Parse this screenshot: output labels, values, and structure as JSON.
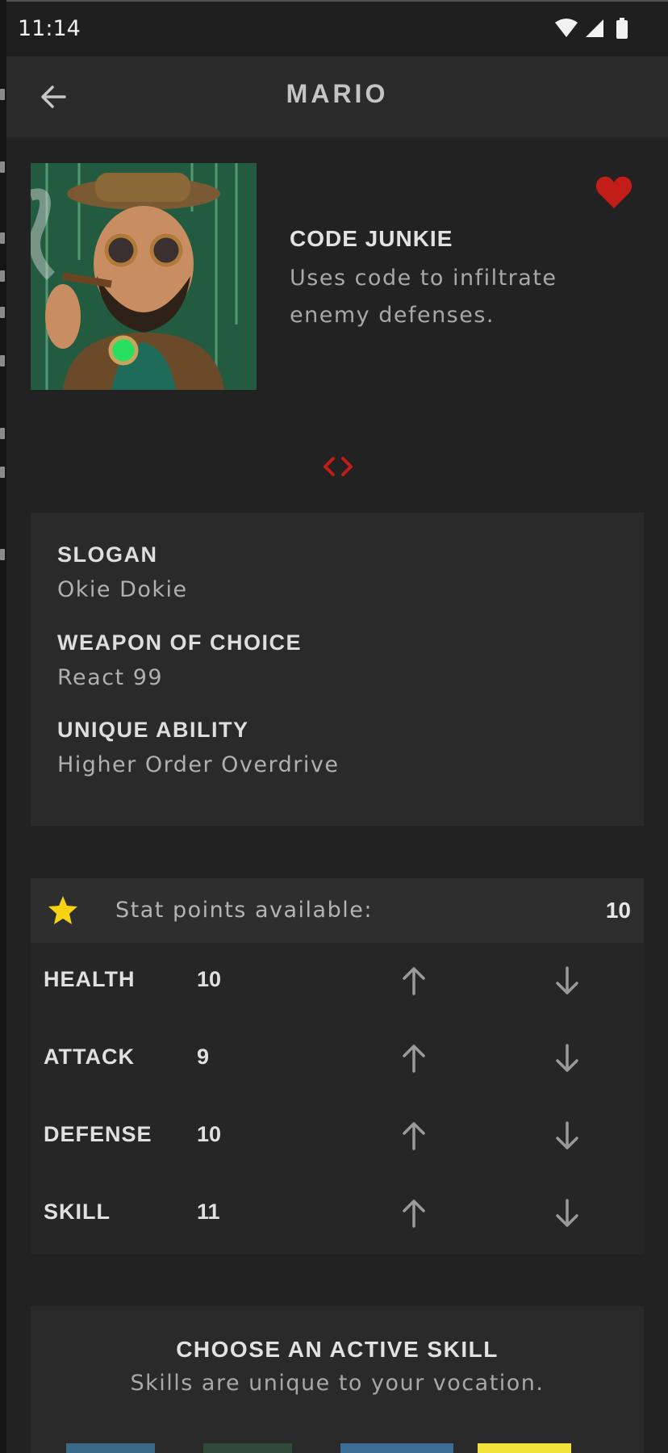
{
  "status_bar": {
    "time": "11:14",
    "icons": [
      "wifi-icon",
      "cellular-signal-icon",
      "battery-icon"
    ]
  },
  "app_bar": {
    "title": "MARIO",
    "back_icon": "arrow-left-icon"
  },
  "character": {
    "vocation_name": "CODE JUNKIE",
    "vocation_description": "Uses code to infiltrate enemy defenses.",
    "favorite_icon": "heart-icon",
    "favorite_color": "#c21d17",
    "vocation_icon": "code-brackets-icon",
    "vocation_icon_color": "#c21d17"
  },
  "info": {
    "slogan_label": "SLOGAN",
    "slogan_value": "Okie Dokie",
    "weapon_label": "WEAPON OF CHOICE",
    "weapon_value": "React 99",
    "ability_label": "UNIQUE ABILITY",
    "ability_value": "Higher Order Overdrive"
  },
  "stats": {
    "points_icon": "star-icon",
    "points_icon_color": "#f5d313",
    "points_label": "Stat points available:",
    "points_value": "10",
    "rows": [
      {
        "name": "HEALTH",
        "value": "10"
      },
      {
        "name": "ATTACK",
        "value": "9"
      },
      {
        "name": "DEFENSE",
        "value": "10"
      },
      {
        "name": "SKILL",
        "value": "11"
      }
    ]
  },
  "skills": {
    "title": "CHOOSE AN ACTIVE SKILL",
    "subtitle": "Skills are unique to your vocation.",
    "selected_color": "#f2e33a"
  }
}
